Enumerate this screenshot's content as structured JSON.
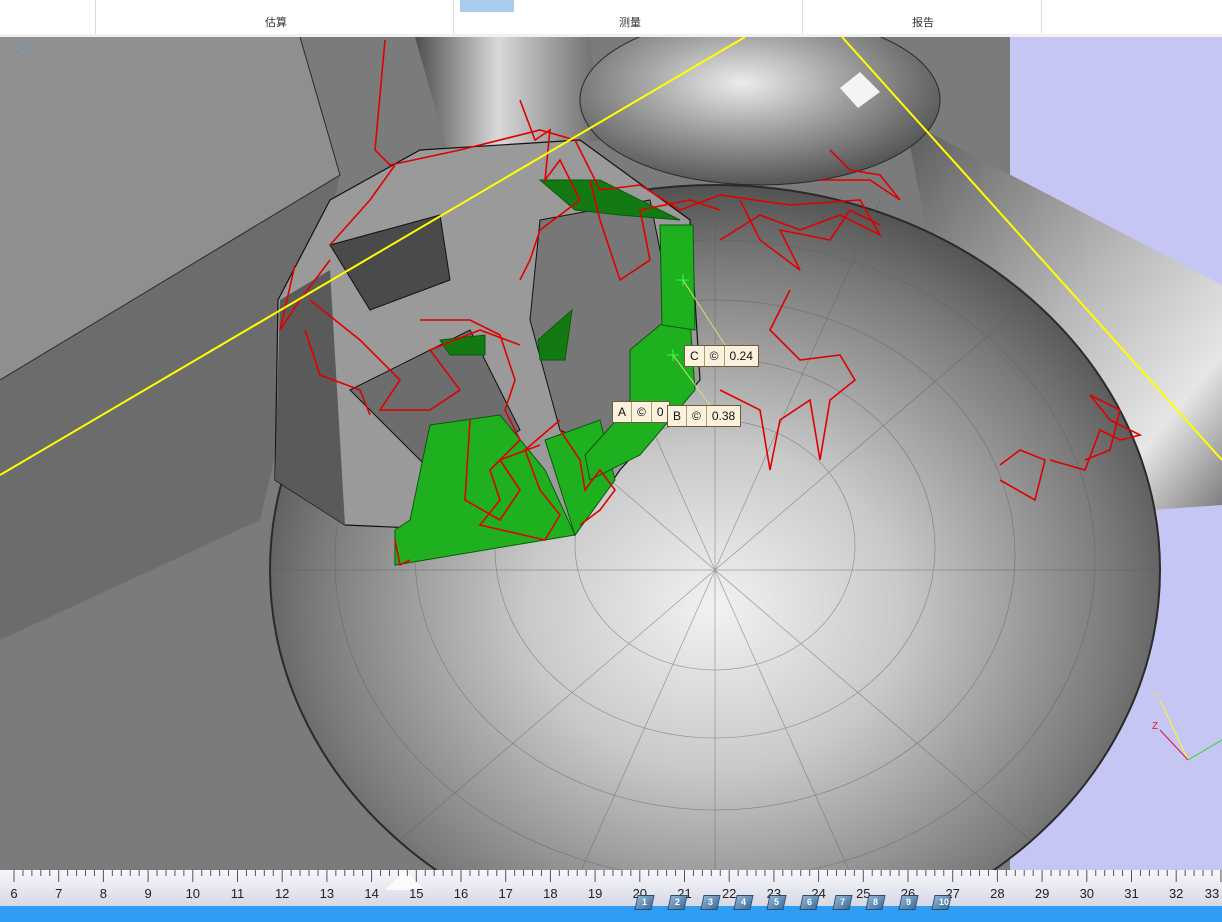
{
  "toolbar": {
    "tabs": [
      {
        "label": "估算"
      },
      {
        "label": "测量"
      },
      {
        "label": "报告"
      }
    ]
  },
  "viewport": {
    "background_color": "#c6c6f4",
    "callouts": {
      "A": {
        "letter": "A",
        "icon": "©",
        "value": "0"
      },
      "B": {
        "letter": "B",
        "icon": "©",
        "value": "0.38"
      },
      "C": {
        "letter": "C",
        "icon": "©",
        "value": "0.24"
      }
    },
    "axis_gizmo": {
      "y": "Y",
      "z": "Z"
    }
  },
  "ruler": {
    "labels": [
      "6",
      "7",
      "8",
      "9",
      "10",
      "11",
      "12",
      "13",
      "14",
      "15",
      "16",
      "17",
      "18",
      "19",
      "20",
      "21",
      "22",
      "23",
      "24",
      "25",
      "26",
      "27",
      "28",
      "29",
      "30",
      "31",
      "32",
      "33"
    ]
  },
  "view_buttons": [
    "1",
    "2",
    "3",
    "4",
    "5",
    "6",
    "7",
    "8",
    "9",
    "10"
  ],
  "colors": {
    "status_bar": "#2f9df3",
    "measure_line": "#ffff00",
    "contour": "#e00000",
    "highlight": "#22c022"
  }
}
